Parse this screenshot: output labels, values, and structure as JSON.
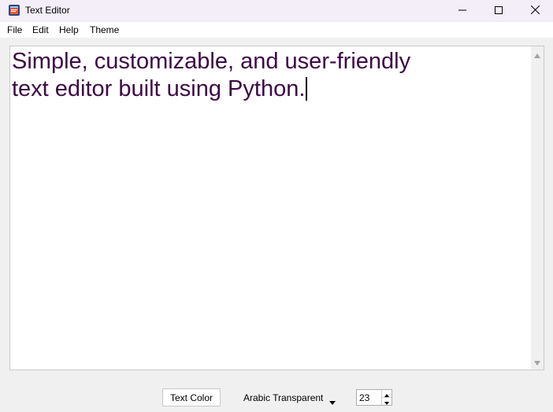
{
  "window": {
    "title": "Text Editor",
    "app_icon": "notepad-icon",
    "controls": [
      "minimize-icon",
      "maximize-icon",
      "close-icon"
    ]
  },
  "menu": {
    "items": [
      "File",
      "Edit",
      "Help",
      "Theme"
    ]
  },
  "editor": {
    "content": "Simple, customizable, and user-friendly\ntext editor built using Python.",
    "text_color": "#3d0a45"
  },
  "toolbar": {
    "text_color_label": "Text Color",
    "font_name": "Arabic Transparent",
    "font_size": "23"
  }
}
